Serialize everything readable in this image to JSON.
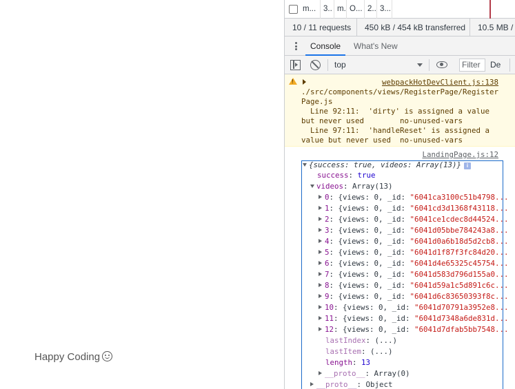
{
  "page": {
    "text": "Happy Coding",
    "emoji_icon": "smiley-icon"
  },
  "network": {
    "row_cells": [
      "m...",
      "3..",
      "m..",
      "O...",
      "2..",
      "3..."
    ],
    "summary": {
      "requests": "10 / 11 requests",
      "transferred": "450 kB / 454 kB transferred",
      "resources": "10.5 MB /"
    }
  },
  "drawer": {
    "tabs": [
      {
        "label": "Console",
        "active": true
      },
      {
        "label": "What's New",
        "active": false
      }
    ]
  },
  "toolbar": {
    "context": "top",
    "filter_placeholder": "Filter",
    "levels": "De"
  },
  "console": {
    "warning": {
      "source": "webpackHotDevClient.js:138",
      "lines": [
        "./src/components/views/RegisterPage/Register",
        "Page.js",
        "  Line 92:11:  'dirty' is assigned a value",
        "but never used        no-unused-vars",
        "  Line 97:11:  'handleReset' is assigned a",
        "value but never used  no-unused-vars"
      ]
    },
    "log": {
      "source": "LandingPage.js:12",
      "summary": "{success: true, videos: Array(13)}",
      "success_key": "success",
      "success_value": "true",
      "videos_key": "videos",
      "videos_value": "Array(13)",
      "items": [
        {
          "index": "0",
          "id": "\"6041ca3100c51b4798..."
        },
        {
          "index": "1",
          "id": "\"6041cd3d1368f43118..."
        },
        {
          "index": "2",
          "id": "\"6041ce1cdec8d44524..."
        },
        {
          "index": "3",
          "id": "\"6041d05bbe784243a8..."
        },
        {
          "index": "4",
          "id": "\"6041d0a6b18d5d2cb8..."
        },
        {
          "index": "5",
          "id": "\"6041d1f87f3fc84d20..."
        },
        {
          "index": "6",
          "id": "\"6041d4e65325c45754..."
        },
        {
          "index": "7",
          "id": "\"6041d583d796d155a0..."
        },
        {
          "index": "8",
          "id": "\"6041d59a1c5d891c6c..."
        },
        {
          "index": "9",
          "id": "\"6041d6c83650393f8c..."
        },
        {
          "index": "10",
          "id": "\"6041d70791a3952e8..."
        },
        {
          "index": "11",
          "id": "\"6041d7348a6de831d..."
        },
        {
          "index": "12",
          "id": "\"6041d7dfab5bb7548..."
        }
      ],
      "item_views_text": "{views: 0, _id: ",
      "last_index": "lastIndex",
      "last_index_value": "(...)",
      "last_item": "lastItem",
      "last_item_value": "(...)",
      "length_key": "length",
      "length_value": "13",
      "proto_key": "__proto__",
      "proto_array": "Array(0)",
      "proto_object": "Object"
    }
  }
}
